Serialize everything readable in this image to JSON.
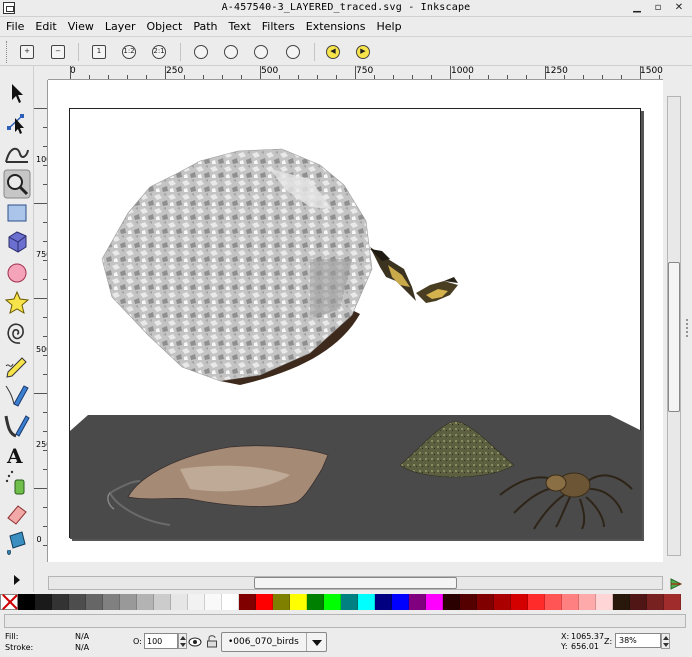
{
  "window": {
    "title": "A-457540-3_LAYERED_traced.svg - Inkscape"
  },
  "menubar": {
    "items": [
      "File",
      "Edit",
      "View",
      "Layer",
      "Object",
      "Path",
      "Text",
      "Filters",
      "Extensions",
      "Help"
    ]
  },
  "commands": {
    "zoom_buttons": [
      "zoom-in",
      "zoom-out",
      "zoom-1-1",
      "zoom-1-2",
      "zoom-2-1",
      "zoom-selection",
      "zoom-drawing",
      "zoom-page",
      "zoom-page-width",
      "zoom-prev",
      "zoom-next"
    ],
    "labels": {
      "zoom-1-1": "1",
      "zoom-1-2": "1:2",
      "zoom-2-1": "2:1"
    }
  },
  "ruler": {
    "horizontal_labels": [
      "0",
      "250",
      "500",
      "750",
      "1000",
      "1250",
      "1500"
    ],
    "vertical_labels": [
      "1000",
      "750",
      "500",
      "250",
      "0"
    ]
  },
  "tools": [
    "selector-tool",
    "node-tool",
    "tweak-tool",
    "zoom-tool",
    "rectangle-tool",
    "3d-box-tool",
    "ellipse-tool",
    "star-tool",
    "spiral-tool",
    "pencil-tool",
    "pen-tool",
    "calligraphy-tool",
    "text-tool",
    "spray-tool",
    "eraser-tool",
    "paint-bucket-tool"
  ],
  "active_tool": "zoom-tool",
  "palette": {
    "colors": [
      "#000000",
      "#1a1a1a",
      "#333333",
      "#4d4d4d",
      "#666666",
      "#808080",
      "#999999",
      "#b3b3b3",
      "#cccccc",
      "#e6e6e6",
      "#f2f2f2",
      "#f9f9f9",
      "#ffffff",
      "#800000",
      "#ff0000",
      "#808000",
      "#ffff00",
      "#008000",
      "#00ff00",
      "#008080",
      "#00ffff",
      "#000080",
      "#0000ff",
      "#800080",
      "#ff00ff",
      "#2b0000",
      "#550000",
      "#800000",
      "#aa0000",
      "#d40000",
      "#ff2a2a",
      "#ff5555",
      "#ff8080",
      "#ffaaaa",
      "#ffd5d5",
      "#28170b",
      "#501616",
      "#782121",
      "#a02c2c"
    ]
  },
  "status": {
    "fill_label": "Fill:",
    "fill_value": "N/A",
    "stroke_label": "Stroke:",
    "stroke_value": "N/A",
    "opacity_label": "O:",
    "opacity_value": "100",
    "layer_name": "•006_070_birds",
    "x_label": "X:",
    "x_value": "1065.37",
    "y_label": "Y:",
    "y_value": "656.01",
    "zoom_label": "Z:",
    "zoom_value": "38%"
  },
  "colors": {
    "platform": "#4a4a4a",
    "rock": "#c9c9c9",
    "highlight_tool": "#c6c6c6"
  }
}
